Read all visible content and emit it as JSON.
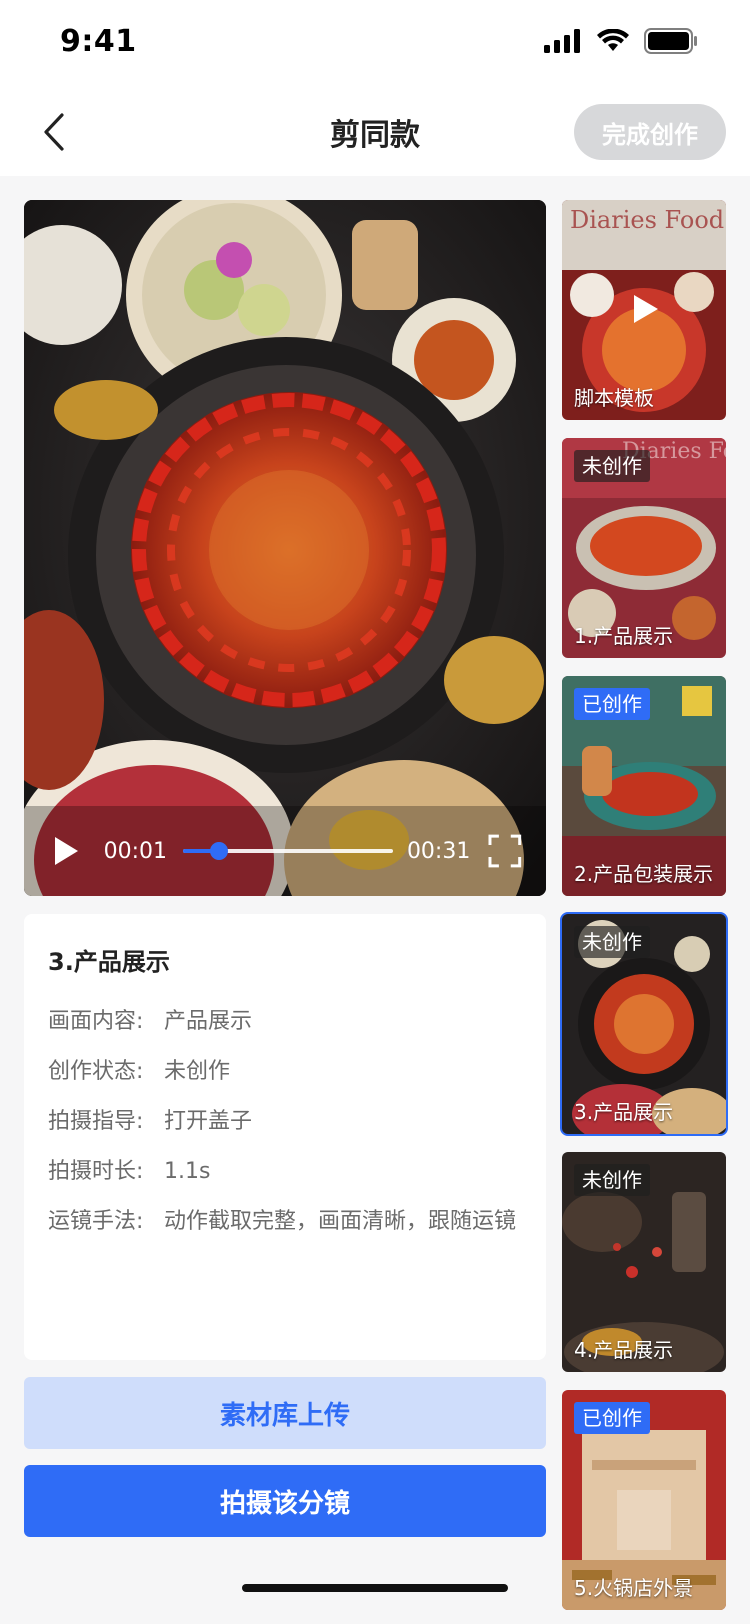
{
  "status_bar": {
    "time": "9:41"
  },
  "nav": {
    "title": "剪同款",
    "finish_label": "完成创作"
  },
  "player": {
    "current_time": "00:01",
    "total_time": "00:31",
    "progress_fraction": 0.17
  },
  "details": {
    "title": "3.产品展示",
    "rows": [
      {
        "key": "画面内容:",
        "value": "产品展示"
      },
      {
        "key": "创作状态:",
        "value": "未创作"
      },
      {
        "key": "拍摄指导:",
        "value": "打开盖子"
      },
      {
        "key": "拍摄时长:",
        "value": "1.1s"
      },
      {
        "key": "运镜手法:",
        "value": "动作截取完整，画面清晰，跟随运镜"
      }
    ]
  },
  "actions": {
    "upload_label": "素材库上传",
    "shoot_label": "拍摄该分镜"
  },
  "thumbnails": [
    {
      "label": "脚本模板",
      "badge": "",
      "watermark": "Diaries Food"
    },
    {
      "label": "1.产品展示",
      "badge": "未创作",
      "watermark": "Diaries Food"
    },
    {
      "label": "2.产品包装展示",
      "badge": "已创作"
    },
    {
      "label": "3.产品展示",
      "badge": "未创作"
    },
    {
      "label": "4.产品展示",
      "badge": "未创作"
    },
    {
      "label": "5.火锅店外景",
      "badge": "已创作"
    }
  ],
  "colors": {
    "accent": "#2f6cf6",
    "accent_light": "#cfddfb",
    "disabled": "#d7d8da"
  }
}
